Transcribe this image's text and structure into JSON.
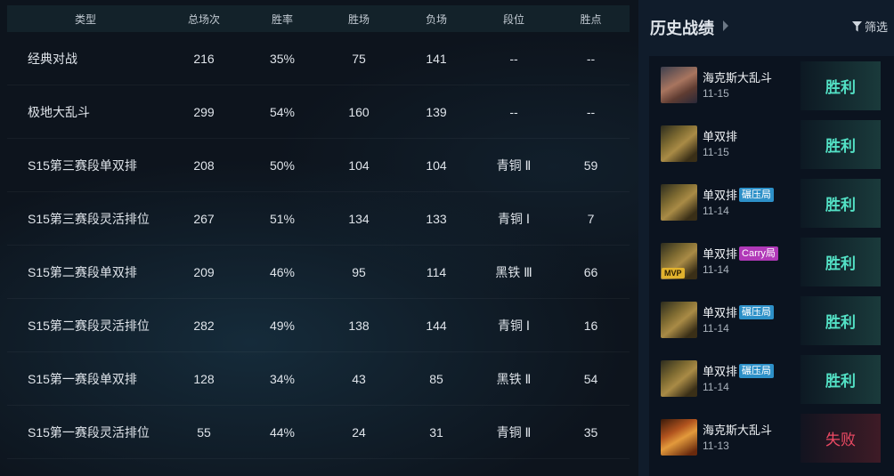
{
  "stats": {
    "headers": {
      "type": "类型",
      "total": "总场次",
      "winrate": "胜率",
      "wins": "胜场",
      "losses": "负场",
      "tier": "段位",
      "lp": "胜点"
    },
    "rows": [
      {
        "type": "经典对战",
        "total": "216",
        "winrate": "35%",
        "wins": "75",
        "losses": "141",
        "tier": "--",
        "lp": "--"
      },
      {
        "type": "极地大乱斗",
        "total": "299",
        "winrate": "54%",
        "wins": "160",
        "losses": "139",
        "tier": "--",
        "lp": "--"
      },
      {
        "type": "S15第三赛段单双排",
        "total": "208",
        "winrate": "50%",
        "wins": "104",
        "losses": "104",
        "tier": "青铜 Ⅱ",
        "lp": "59"
      },
      {
        "type": "S15第三赛段灵活排位",
        "total": "267",
        "winrate": "51%",
        "wins": "134",
        "losses": "133",
        "tier": "青铜 Ⅰ",
        "lp": "7"
      },
      {
        "type": "S15第二赛段单双排",
        "total": "209",
        "winrate": "46%",
        "wins": "95",
        "losses": "114",
        "tier": "黑铁 Ⅲ",
        "lp": "66"
      },
      {
        "type": "S15第二赛段灵活排位",
        "total": "282",
        "winrate": "49%",
        "wins": "138",
        "losses": "144",
        "tier": "青铜 Ⅰ",
        "lp": "16"
      },
      {
        "type": "S15第一赛段单双排",
        "total": "128",
        "winrate": "34%",
        "wins": "43",
        "losses": "85",
        "tier": "黑铁 Ⅱ",
        "lp": "54"
      },
      {
        "type": "S15第一赛段灵活排位",
        "total": "55",
        "winrate": "44%",
        "wins": "24",
        "losses": "31",
        "tier": "青铜 Ⅱ",
        "lp": "35"
      }
    ]
  },
  "history": {
    "title": "历史战绩",
    "filter_label": "筛选",
    "items": [
      {
        "mode": "海克斯大乱斗",
        "tag": "",
        "date": "11-15",
        "result": "胜利",
        "mvp": ""
      },
      {
        "mode": "单双排",
        "tag": "",
        "date": "11-15",
        "result": "胜利",
        "mvp": ""
      },
      {
        "mode": "单双排",
        "tag": "碾压局",
        "date": "11-14",
        "result": "胜利",
        "mvp": ""
      },
      {
        "mode": "单双排",
        "tag": "Carry局",
        "date": "11-14",
        "result": "胜利",
        "mvp": "MVP"
      },
      {
        "mode": "单双排",
        "tag": "碾压局",
        "date": "11-14",
        "result": "胜利",
        "mvp": ""
      },
      {
        "mode": "单双排",
        "tag": "碾压局",
        "date": "11-14",
        "result": "胜利",
        "mvp": ""
      },
      {
        "mode": "海克斯大乱斗",
        "tag": "",
        "date": "11-13",
        "result": "失败",
        "mvp": ""
      }
    ]
  },
  "colors": {
    "win": "#53e1c5",
    "lose": "#ef4a64",
    "tag_crush": "#2d90c8",
    "tag_carry": "#b139b8",
    "mvp": "#e1b22d"
  }
}
